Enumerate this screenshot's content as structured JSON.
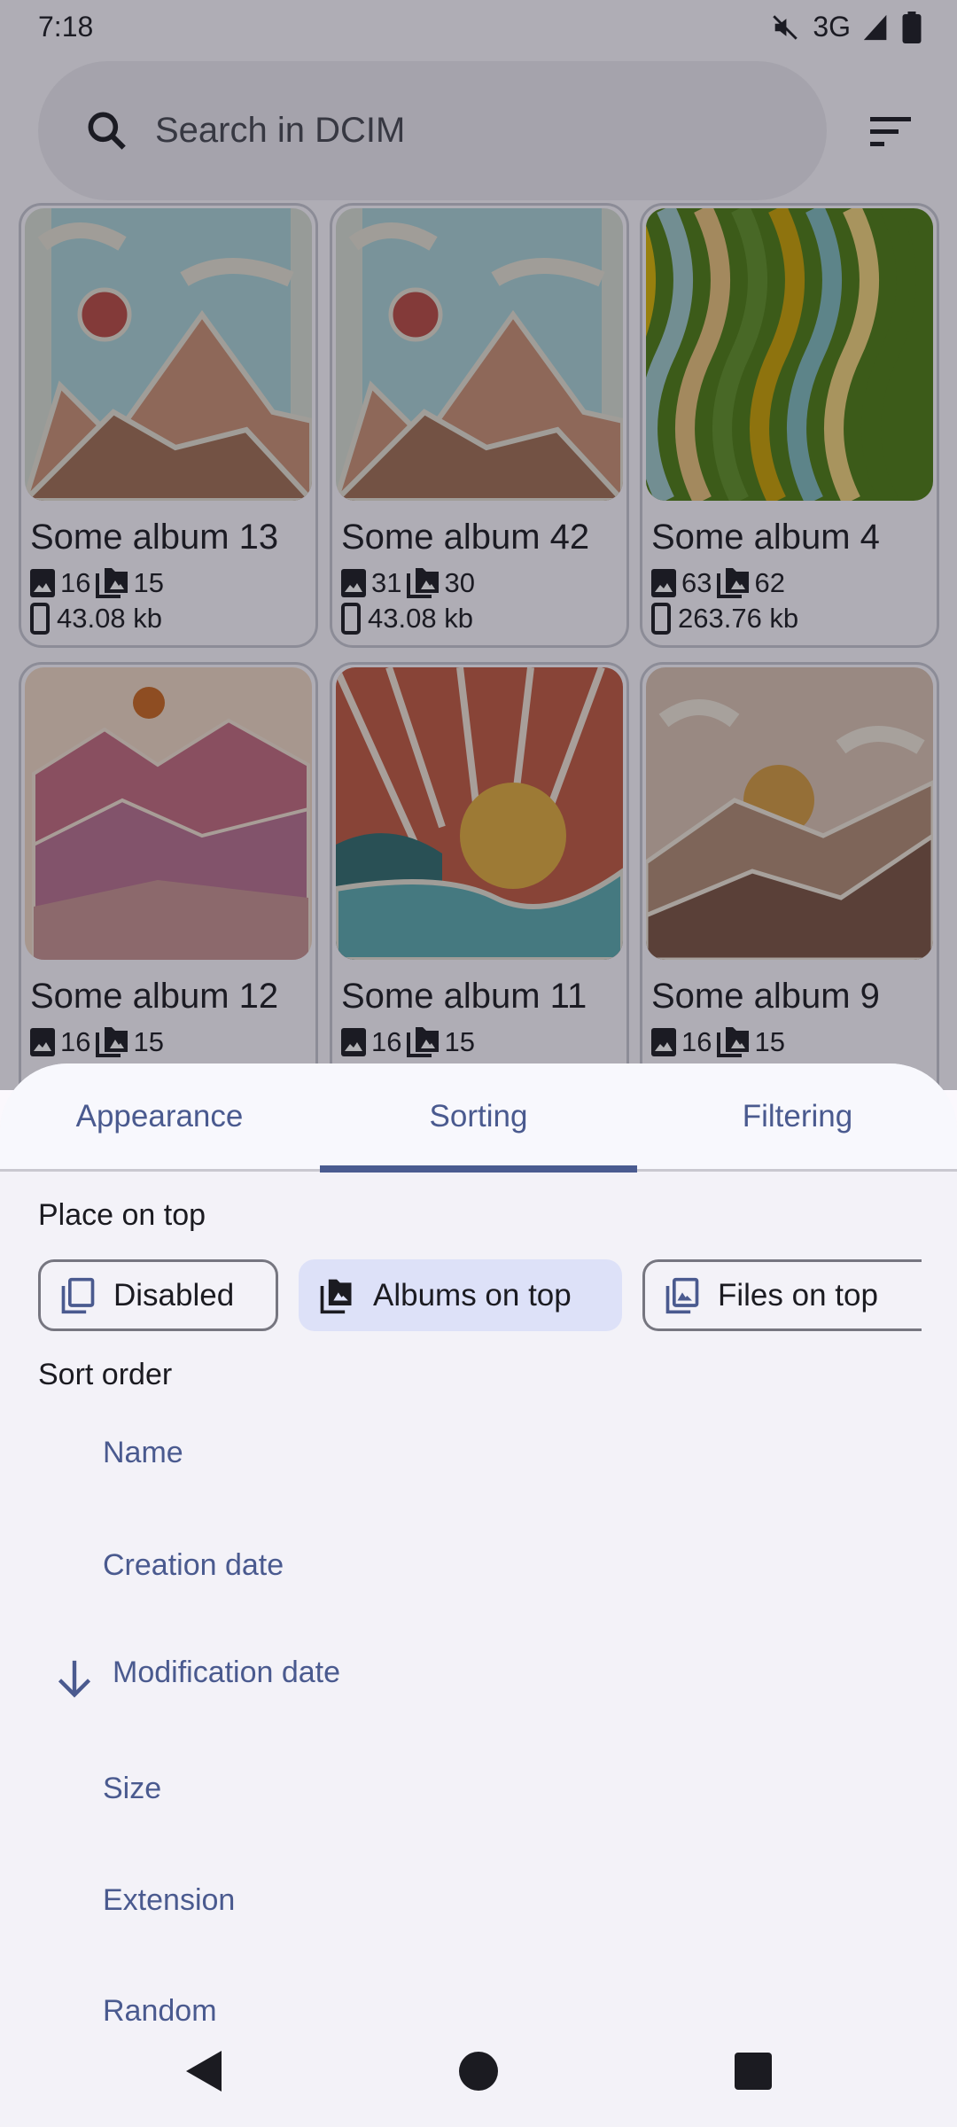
{
  "status_bar": {
    "time": "7:18",
    "network": "3G"
  },
  "search": {
    "placeholder": "Search in DCIM"
  },
  "albums": [
    {
      "title": "Some album 13",
      "files": "16",
      "albums": "15",
      "size": "43.08 kb",
      "art": "mountains-sun"
    },
    {
      "title": "Some album 42",
      "files": "31",
      "albums": "30",
      "size": "43.08 kb",
      "art": "mountains-sun"
    },
    {
      "title": "Some album 4",
      "files": "63",
      "albums": "62",
      "size": "263.76 kb",
      "art": "waves"
    },
    {
      "title": "Some album 12",
      "files": "16",
      "albums": "15",
      "art": "pink-hills"
    },
    {
      "title": "Some album 11",
      "files": "16",
      "albums": "15",
      "art": "sunrise-sea"
    },
    {
      "title": "Some album 9",
      "files": "16",
      "albums": "15",
      "art": "brown-hills"
    }
  ],
  "sheet": {
    "tabs": [
      {
        "label": "Appearance"
      },
      {
        "label": "Sorting"
      },
      {
        "label": "Filtering"
      }
    ],
    "selected_tab": "Sorting",
    "place_on_top": {
      "label": "Place on top",
      "options": [
        {
          "label": "Disabled"
        },
        {
          "label": "Albums on top"
        },
        {
          "label": "Files on top"
        }
      ],
      "selected": "Albums on top"
    },
    "sort_order": {
      "label": "Sort order",
      "options": [
        {
          "label": "Name"
        },
        {
          "label": "Creation date"
        },
        {
          "label": "Modification date"
        },
        {
          "label": "Size"
        },
        {
          "label": "Extension"
        },
        {
          "label": "Random"
        }
      ],
      "selected": "Modification date",
      "direction": "descending"
    }
  },
  "colors": {
    "accent": "#4a5a8f",
    "chip_selected": "#dde1f8"
  }
}
